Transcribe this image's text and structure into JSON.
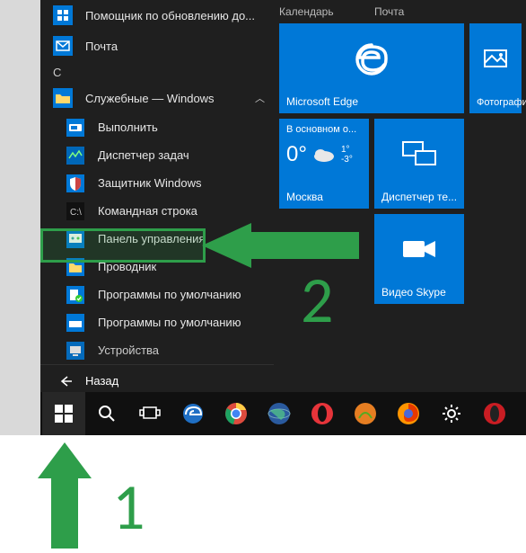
{
  "apps": {
    "update_assistant": "Помощник по обновлению до...",
    "mail": "Почта",
    "section_c": "С",
    "system_tools": "Служебные — Windows",
    "run": "Выполнить",
    "task_manager": "Диспетчер задач",
    "defender": "Защитник Windows",
    "cmd": "Командная строка",
    "control_panel": "Панель управления",
    "explorer": "Проводник",
    "default_programs": "Программы по умолчанию",
    "default_programs2": "Программы по умолчанию",
    "devices": "Устройства",
    "back": "Назад"
  },
  "tiles": {
    "calendar": "Календарь",
    "mail": "Почта",
    "edge": "Microsoft Edge",
    "photos": "Фотографии",
    "weather_title": "В основном о...",
    "weather_temp": "0°",
    "weather_hi": "1°",
    "weather_lo": "-3°",
    "weather_city": "Москва",
    "remote": "Диспетчер те...",
    "skype": "Видео Skype"
  },
  "annotations": {
    "one": "1",
    "two": "2"
  }
}
